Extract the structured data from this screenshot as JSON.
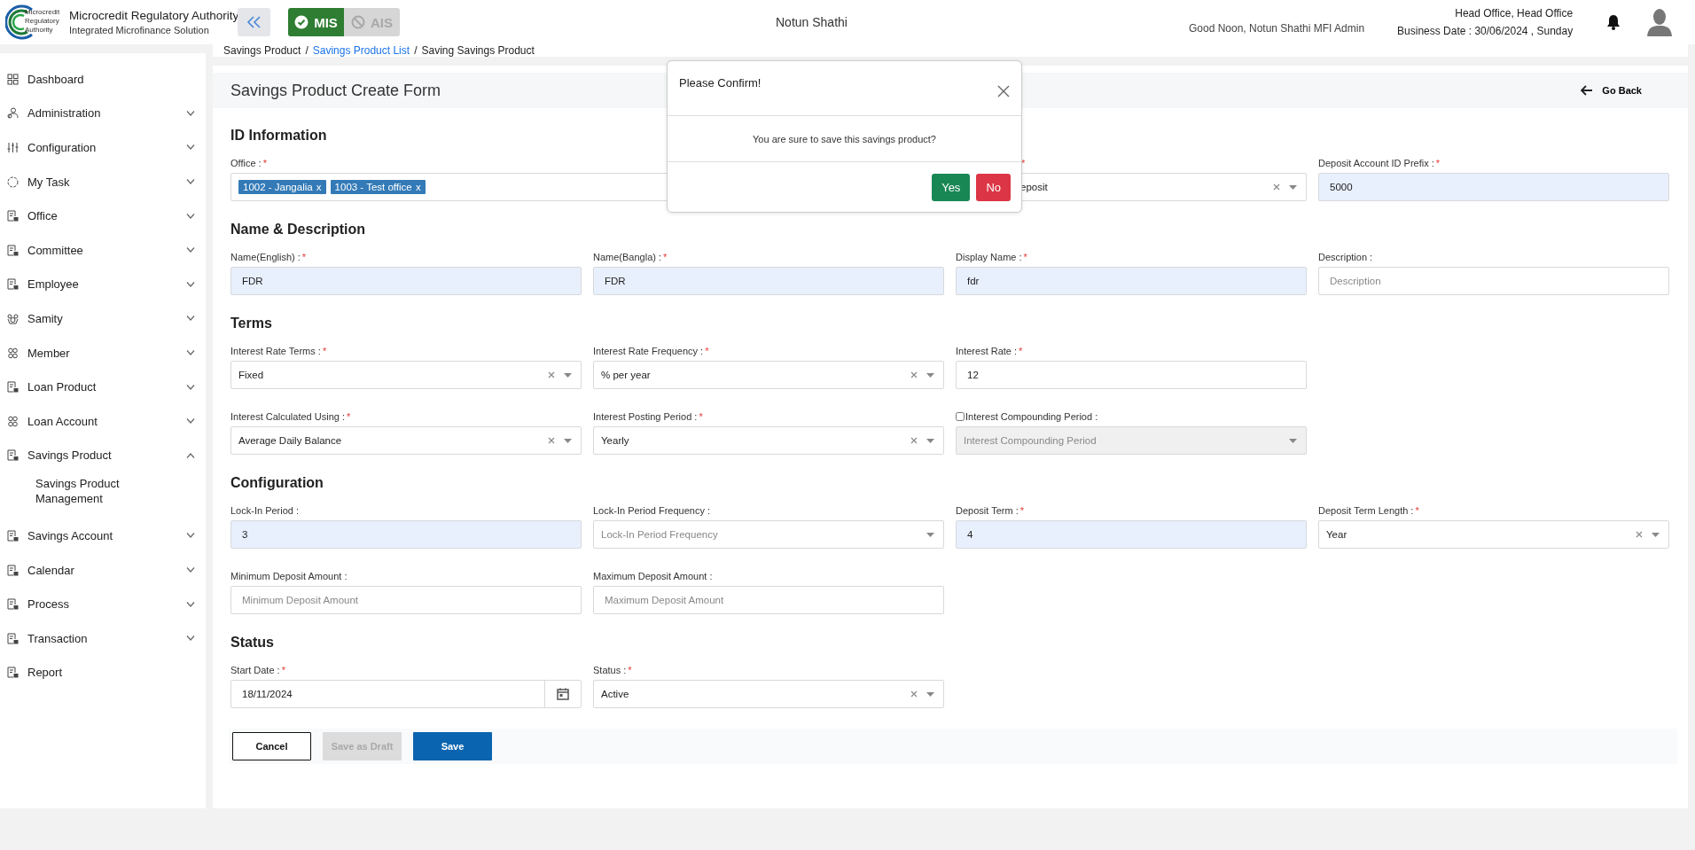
{
  "header": {
    "logo_lines": [
      "Microcredit",
      "Regulatory",
      "Authority"
    ],
    "org_name": "Microcredit Regulatory Authority",
    "org_subtitle": "Integrated Microfinance Solution",
    "modules": [
      {
        "label": "MIS",
        "selected": true
      },
      {
        "label": "AIS",
        "selected": false
      }
    ],
    "center_title": "Notun Shathi",
    "greeting": "Good Noon, Notun Shathi MFI Admin",
    "office": "Head Office, Head Office",
    "business_date": "Business Date : 30/06/2024 , Sunday"
  },
  "breadcrumb": [
    {
      "label": "Savings Product",
      "link": false
    },
    {
      "separator": "/",
      "label": "Savings Product List",
      "link": true
    },
    {
      "separator": "/",
      "label": "Saving Savings Product",
      "link": false
    }
  ],
  "sidebar": {
    "items": [
      {
        "label": "Dashboard",
        "kind": "grid",
        "expandable": false
      },
      {
        "label": "Administration",
        "kind": "admin",
        "expandable": true,
        "expanded": false
      },
      {
        "label": "Configuration",
        "kind": "sliders",
        "expandable": true,
        "expanded": false
      },
      {
        "label": "My Task",
        "kind": "task",
        "expandable": true,
        "expanded": false
      },
      {
        "label": "Office",
        "kind": "doc",
        "expandable": true,
        "expanded": false
      },
      {
        "label": "Committee",
        "kind": "doc",
        "expandable": true,
        "expanded": false
      },
      {
        "label": "Employee",
        "kind": "doc",
        "expandable": true,
        "expanded": false
      },
      {
        "label": "Samity",
        "kind": "samity",
        "expandable": true,
        "expanded": false
      },
      {
        "label": "Member",
        "kind": "people",
        "expandable": true,
        "expanded": false
      },
      {
        "label": "Loan Product",
        "kind": "doc",
        "expandable": true,
        "expanded": false
      },
      {
        "label": "Loan Account",
        "kind": "people",
        "expandable": true,
        "expanded": false
      },
      {
        "label": "Savings Product",
        "kind": "doc",
        "expandable": true,
        "expanded": true,
        "children": [
          {
            "label": "Savings Product Management"
          }
        ]
      },
      {
        "label": "Savings Account",
        "kind": "doc",
        "expandable": true,
        "expanded": false
      },
      {
        "label": "Calendar",
        "kind": "doc",
        "expandable": true,
        "expanded": false
      },
      {
        "label": "Process",
        "kind": "doc",
        "expandable": true,
        "expanded": false
      },
      {
        "label": "Transaction",
        "kind": "doc",
        "expandable": true,
        "expanded": false
      },
      {
        "label": "Report",
        "kind": "doc",
        "expandable": false
      }
    ]
  },
  "form": {
    "title": "Savings Product Create Form",
    "back": "Go Back",
    "sections": [
      {
        "title": "ID Information",
        "rows": [
          [
            {
              "kind": "tags",
              "label": "Office :",
              "required_mark": "*",
              "tags": [
                {
                  "label": "1002 - Jangalia",
                  "remove": "x"
                },
                {
                  "label": "1003 - Test office",
                  "remove": "x"
                }
              ]
            },
            {
              "kind": "covered",
              "required_mark": "*",
              "value": "eposit",
              "clearable": true
            },
            {
              "kind": "text",
              "label": "Deposit Account ID Prefix :",
              "required_mark": "*",
              "value": "5000",
              "filled": true
            }
          ]
        ]
      },
      {
        "title": "Name & Description",
        "rows": [
          [
            {
              "kind": "text",
              "label": "Name(English) :",
              "required_mark": "*",
              "value": "FDR",
              "filled": true
            },
            {
              "kind": "text",
              "label": "Name(Bangla) :",
              "required_mark": "*",
              "value": "FDR",
              "filled": true
            },
            {
              "kind": "text",
              "label": "Display Name :",
              "required_mark": "*",
              "value": "fdr",
              "filled": true
            },
            {
              "kind": "text",
              "label": "Description :",
              "placeholder": "Description",
              "filled": false
            }
          ]
        ]
      },
      {
        "title": "Terms",
        "rows": [
          [
            {
              "kind": "select",
              "label": "Interest Rate Terms :",
              "required_mark": "*",
              "value": "Fixed",
              "clearable": true,
              "disabled": false
            },
            {
              "kind": "select",
              "label": "Interest Rate Frequency :",
              "required_mark": "*",
              "value": "% per year",
              "clearable": true,
              "disabled": false
            },
            {
              "kind": "text",
              "label": "Interest Rate :",
              "required_mark": "*",
              "value": "12",
              "filled": false
            }
          ],
          [
            {
              "kind": "select",
              "label": "Interest Calculated Using :",
              "required_mark": "*",
              "value": "Average Daily Balance",
              "clearable": true,
              "disabled": false
            },
            {
              "kind": "select",
              "label": "Interest Posting Period :",
              "required_mark": "*",
              "value": "Yearly",
              "clearable": true,
              "disabled": false
            },
            {
              "kind": "select",
              "label": "Interest Compounding Period :",
              "checked": false,
              "placeholder": "Interest Compounding Period",
              "clearable": false,
              "disabled": true
            }
          ]
        ]
      },
      {
        "title": "Configuration",
        "rows": [
          [
            {
              "kind": "text",
              "label": "Lock-In Period :",
              "value": "3",
              "filled": true
            },
            {
              "kind": "select",
              "label": "Lock-In Period Frequency :",
              "placeholder": "Lock-In Period Frequency",
              "clearable": false,
              "disabled": false
            },
            {
              "kind": "text",
              "label": "Deposit Term :",
              "required_mark": "*",
              "value": "4",
              "filled": true
            },
            {
              "kind": "select",
              "label": "Deposit Term Length :",
              "required_mark": "*",
              "value": "Year",
              "clearable": true,
              "disabled": false
            }
          ],
          [
            {
              "kind": "text",
              "label": "Minimum Deposit Amount :",
              "placeholder": "Minimum Deposit Amount",
              "filled": false
            },
            {
              "kind": "text",
              "label": "Maximum Deposit Amount :",
              "placeholder": "Maximum Deposit Amount",
              "filled": false
            }
          ]
        ]
      },
      {
        "title": "Status",
        "rows": [
          [
            {
              "kind": "date",
              "label": "Start Date :",
              "required_mark": "*",
              "value": "18/11/2024"
            },
            {
              "kind": "select",
              "label": "Status :",
              "required_mark": "*",
              "value": "Active",
              "clearable": true,
              "disabled": false
            }
          ]
        ]
      }
    ],
    "buttons": [
      {
        "label": "Cancel",
        "kind": "outline"
      },
      {
        "label": "Save as Draft",
        "kind": "secondary",
        "disabled": true
      },
      {
        "label": "Save",
        "kind": "primary"
      }
    ]
  },
  "modal": {
    "title": "Please Confirm!",
    "message": "You are sure to save this savings product?",
    "buttons": [
      {
        "label": "Yes",
        "kind": "confirm"
      },
      {
        "label": "No",
        "kind": "cancel"
      }
    ]
  }
}
